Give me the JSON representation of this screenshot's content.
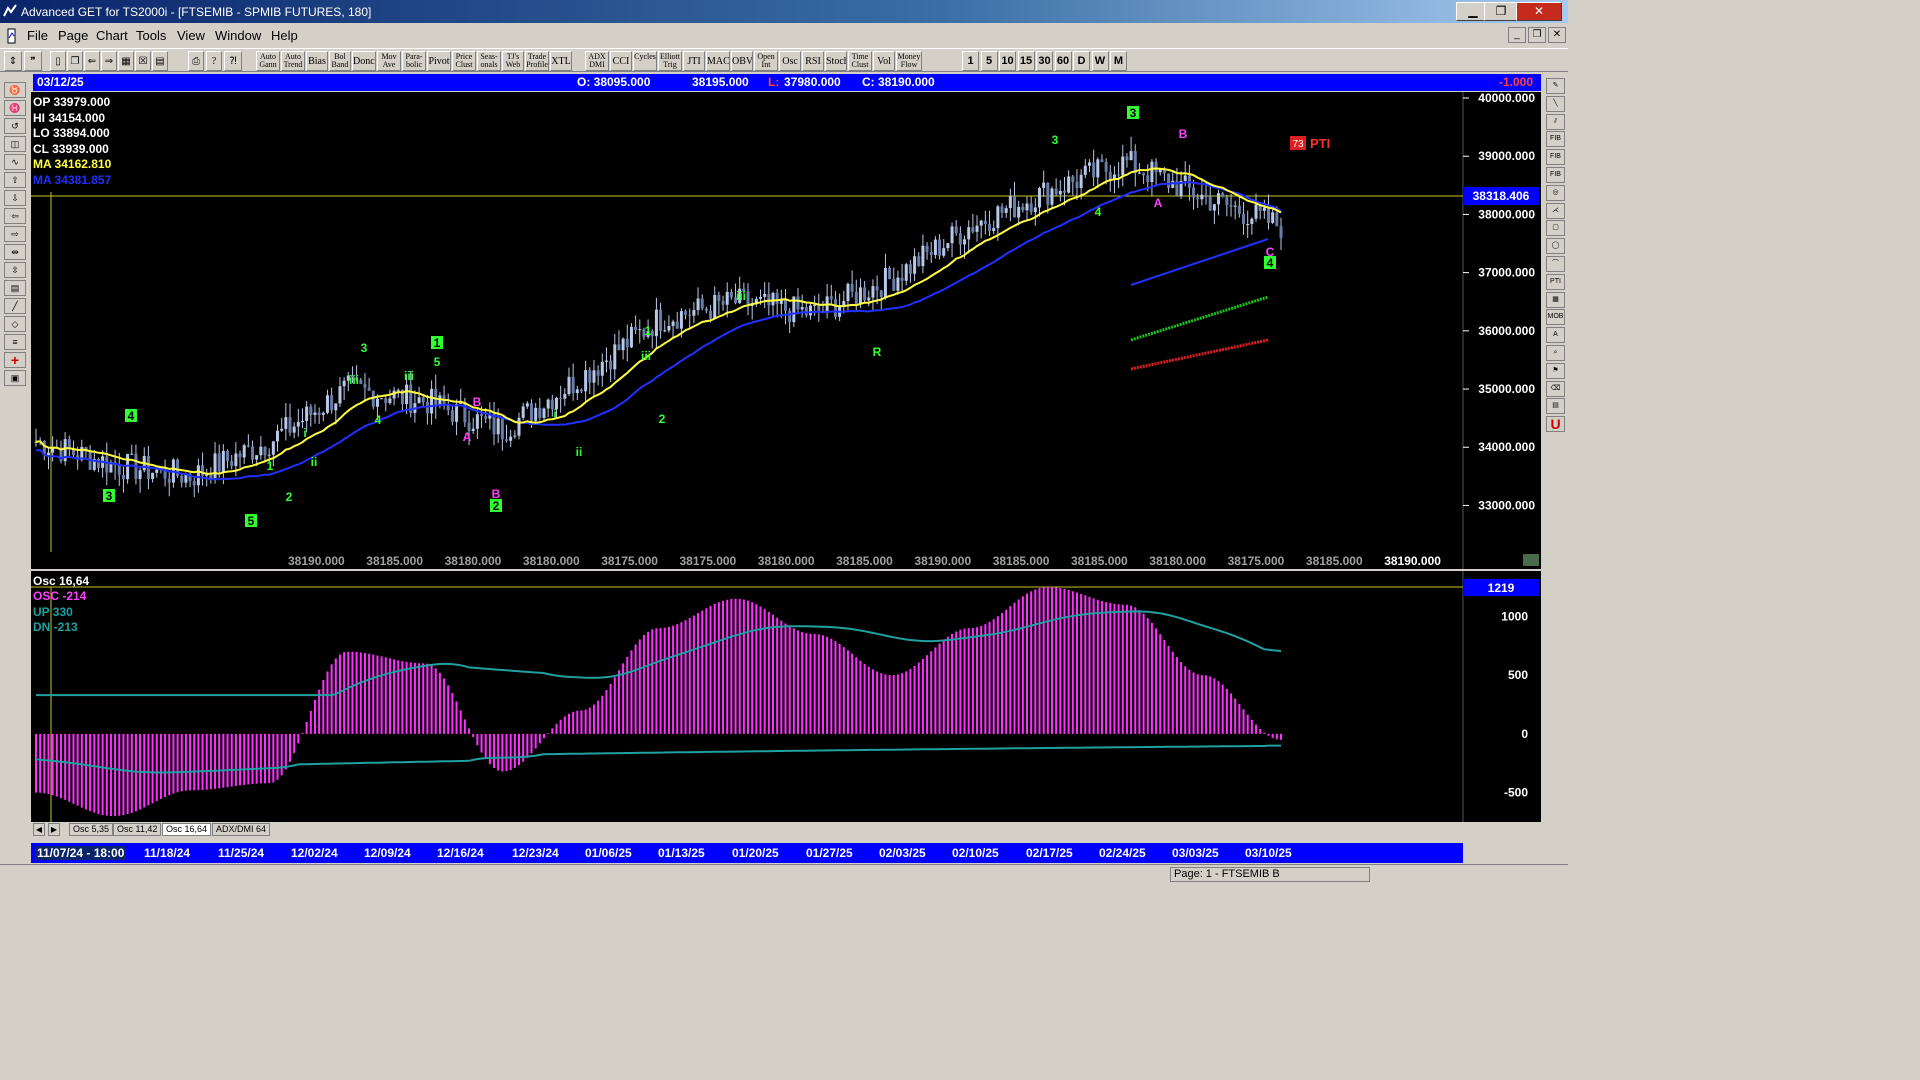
{
  "window": {
    "title": "Advanced GET for TS2000i - [FTSEMIB - SPMIB FUTURES, 180]",
    "min_label": "▁",
    "max_label": "❐",
    "close_label": "✕"
  },
  "menu": [
    "File",
    "Page",
    "Chart",
    "Tools",
    "View",
    "Window",
    "Help"
  ],
  "toolbar": {
    "indicators": [
      "Auto Gann",
      "Auto Trend",
      "Bias",
      "Bol Band",
      "Donch",
      "Mov Ave",
      "Para-bolic",
      "Pivot",
      "Price Clust",
      "Seas-onals",
      "TJ's Web",
      "Trade Profile",
      "XTL",
      "ADX DMI",
      "CCI",
      "Cycles",
      "Elliott Trig",
      "JTI",
      "MACD",
      "OBV",
      "Open Int",
      "Osc",
      "RSI",
      "Stoch",
      "Time Clust",
      "Vol",
      "Money Flow"
    ],
    "periods": [
      "1",
      "5",
      "10",
      "15",
      "30",
      "60",
      "D",
      "W",
      "M"
    ]
  },
  "info_bar": {
    "date": "03/12/25",
    "open": "O: 38095.000",
    "high": "38195.000",
    "low_prefix": "L:",
    "low": "37980.000",
    "close": "C: 38190.000",
    "change": "-1.000"
  },
  "left_readout": {
    "op": "OP 33979.000",
    "hi": "HI  34154.000",
    "lo": "LO  33894.000",
    "cl": "CL  33939.000",
    "ma1": "MA  34162.810",
    "ma2": "MA  34381.857"
  },
  "price_axis": {
    "ticks": [
      "40000.000",
      "39000.000",
      "38000.000",
      "37000.000",
      "36000.000",
      "35000.000",
      "34000.000",
      "33000.000"
    ],
    "current": "38318.406"
  },
  "pti": {
    "value": "73",
    "label": "PTI"
  },
  "bottom_prices": [
    "38190.000",
    "38185.000",
    "38180.000",
    "38180.000",
    "38175.000",
    "38175.000",
    "38180.000",
    "38185.000",
    "38190.000",
    "38185.000",
    "38185.000",
    "38180.000",
    "38175.000",
    "38185.000",
    "38190.000"
  ],
  "osc_panel": {
    "title": "Osc 16,64",
    "osc": "OSC -214",
    "up": "UP   330",
    "dn": "DN   -213",
    "axis_ticks": [
      "1000",
      "500",
      "0",
      "-500"
    ],
    "current": "1219"
  },
  "tabs": [
    "Osc 5,35",
    "Osc 11,42",
    "Osc 16,64",
    "ADX/DMI 64"
  ],
  "active_tab": "Osc 16,64",
  "dates": [
    "11/07/24 - 18:00",
    "11/18/24",
    "11/25/24",
    "12/02/24",
    "12/09/24",
    "12/16/24",
    "12/23/24",
    "01/06/25",
    "01/13/25",
    "01/20/25",
    "01/27/25",
    "02/03/25",
    "02/10/25",
    "02/17/25",
    "02/24/25",
    "03/03/25",
    "03/10/25"
  ],
  "status": {
    "page": "Page: 1 - FTSEMIB B"
  },
  "colors": {
    "bg": "#000000",
    "info_bar": "#0000ff",
    "candle": "#b8c8e8",
    "ma_fast": "#ffff40",
    "ma_slow": "#2030ff",
    "oscillator": "#ff30ff",
    "bands": "#20a0a0",
    "wave_label": "#30ff30",
    "abc_label": "#ff40ff"
  },
  "chart_data": [
    {
      "type": "line",
      "title": "FTSEMIB - SPMIB FUTURES, 180",
      "x": [
        "11/07/24",
        "11/18/24",
        "11/25/24",
        "12/02/24",
        "12/09/24",
        "12/16/24",
        "12/23/24",
        "01/06/25",
        "01/13/25",
        "01/20/25",
        "01/27/25",
        "02/03/25",
        "02/10/25",
        "02/17/25",
        "02/24/25",
        "03/03/25",
        "03/10/25"
      ],
      "series": [
        {
          "name": "",
          "values": [
            34100,
            33700,
            33500,
            34100,
            35000,
            34800,
            34300,
            35200,
            36200,
            36500,
            36300,
            36900,
            37800,
            38400,
            38900,
            38300,
            37800
          ]
        }
      ],
      "ylim": [
        32200,
        40000
      ]
    },
    {
      "type": "bar",
      "title": "Osc 16,64",
      "values": [
        -500,
        -700,
        -480,
        -420,
        700,
        600,
        -320,
        200,
        900,
        1150,
        850,
        500,
        900,
        1250,
        1100,
        500,
        -50
      ],
      "ylim": [
        -750,
        1250
      ]
    }
  ]
}
